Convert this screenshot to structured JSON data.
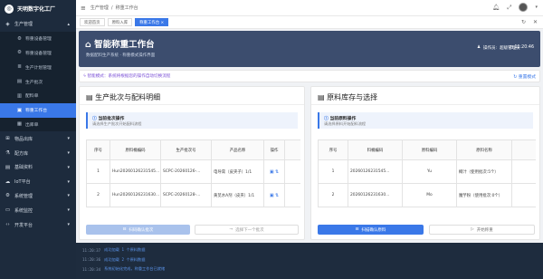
{
  "app": {
    "logo_text": "天明数字化工厂"
  },
  "sidebar": {
    "items": [
      {
        "label": "生产管理",
        "icon": "factory-icon",
        "glyph": "◈",
        "kind": "group",
        "chevron": "▴"
      },
      {
        "label": "称重设备管理",
        "icon": "settings-icon",
        "glyph": "⚙",
        "kind": "sub"
      },
      {
        "label": "称重设备管理",
        "icon": "settings-icon",
        "glyph": "⚙",
        "kind": "sub"
      },
      {
        "label": "生产计划管理",
        "icon": "list-icon",
        "glyph": "≣",
        "kind": "sub"
      },
      {
        "label": "生产批次",
        "icon": "document-icon",
        "glyph": "▤",
        "kind": "sub"
      },
      {
        "label": "配料单",
        "icon": "file-icon",
        "glyph": "▥",
        "kind": "sub"
      },
      {
        "label": "称重工作台",
        "icon": "desktop-icon",
        "glyph": "▣",
        "kind": "sub",
        "active": true
      },
      {
        "label": "出库单",
        "icon": "box-icon",
        "glyph": "▦",
        "kind": "sub"
      },
      {
        "label": "物品出库",
        "icon": "grid-icon",
        "glyph": "⊞",
        "kind": "group",
        "chevron": "▾"
      },
      {
        "label": "配方库",
        "icon": "flask-icon",
        "glyph": "⚗",
        "kind": "group",
        "chevron": "▾"
      },
      {
        "label": "基础资料",
        "icon": "database-icon",
        "glyph": "▤",
        "kind": "group",
        "chevron": "▾"
      },
      {
        "label": "IoT平台",
        "icon": "cloud-icon",
        "glyph": "☁",
        "kind": "group",
        "chevron": "▾"
      },
      {
        "label": "系统管理",
        "icon": "gear-icon",
        "glyph": "⚙",
        "kind": "group",
        "chevron": "▾"
      },
      {
        "label": "系统监控",
        "icon": "monitor-icon",
        "glyph": "▭",
        "kind": "group",
        "chevron": "▾"
      },
      {
        "label": "开发平台",
        "icon": "code-icon",
        "glyph": "‹›",
        "kind": "group",
        "chevron": "▾"
      }
    ]
  },
  "topbar": {
    "breadcrumb": [
      "生产管理",
      "/",
      "称重工作台"
    ],
    "menu_icon": "≡"
  },
  "tabs": [
    {
      "label": "欢迎首页",
      "active": false
    },
    {
      "label": "原料入库",
      "active": false
    },
    {
      "label": "称重工作台 ×",
      "active": true
    }
  ],
  "hero": {
    "title": "智能称重工作台",
    "subtitle": "数据配料生产系统 · 称重模式操作界面",
    "operator_label": "操作员:",
    "operator": "超级管理员",
    "time": "11:20:46"
  },
  "modebar": {
    "text": "智能模式：系统将根据您的操作自动切换流程",
    "reset": "重置模式"
  },
  "left_panel": {
    "title": "生产批次与配料明细",
    "info_title": "当前批次操作",
    "info_desc": "请选择生产批次开始配料流程",
    "columns": [
      "序号",
      "原料桶编码",
      "生产批次号",
      "产品名称",
      "操作"
    ],
    "rows": [
      {
        "no": "1",
        "code": "Hun20260126231545...",
        "batch": "SCPC-20260126-...",
        "product": "电导膏（皮夹子）1/1"
      },
      {
        "no": "2",
        "code": "Hun20260126231630...",
        "batch": "SCPC-20260128-...",
        "product": "黄苋水A剂（皮夹）1/1"
      }
    ],
    "btn_confirm": "扫码确认批次",
    "btn_next": "选择下一个批次"
  },
  "right_panel": {
    "title": "原料库存与选择",
    "info_title": "当前原料操作",
    "info_desc": "请选择原料开始配料流程",
    "columns": [
      "序号",
      "料桶编码",
      "原料编码",
      "原料名称"
    ],
    "rows": [
      {
        "no": "1",
        "code": "20260126231545...",
        "mat": "Yu",
        "name": "椰汁（使用批次:5个）"
      },
      {
        "no": "2",
        "code": "20260126231630...",
        "mat": "Mo",
        "name": "魔芋粉（使用批次:0个）"
      }
    ],
    "btn_scan": "扫描确认原料",
    "btn_start": "开始称重"
  },
  "log": [
    {
      "time": "11:20:37",
      "msg": "成功加载 1 个原料数据"
    },
    {
      "time": "11:20:36",
      "msg": "成功加载 2 个原料数据"
    },
    {
      "time": "11:20:34",
      "msg": "系统初始化完成，称重工作台已就绪"
    }
  ]
}
